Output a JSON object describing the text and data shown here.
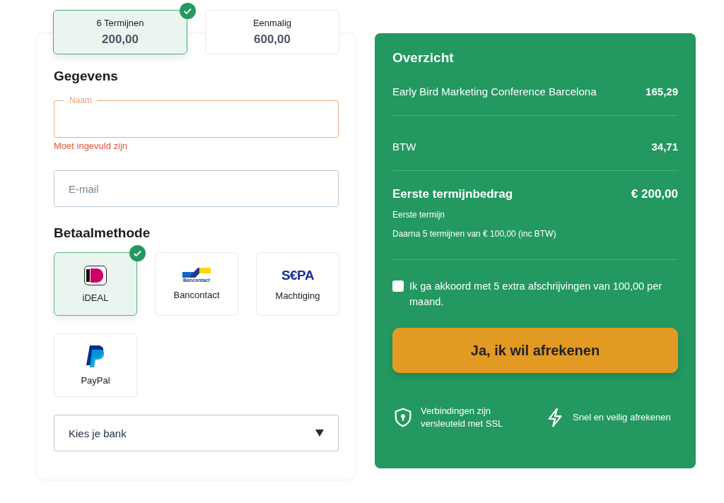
{
  "plans": [
    {
      "label": "6 Termijnen",
      "amount": "200,00",
      "selected": true
    },
    {
      "label": "Eenmalig",
      "amount": "600,00",
      "selected": false
    }
  ],
  "details": {
    "heading": "Gegevens",
    "name_field": {
      "label": "Naam",
      "error": "Moet ingevuld zijn"
    },
    "email_field": {
      "placeholder": "E-mail"
    }
  },
  "payment": {
    "heading": "Betaalmethode",
    "methods": [
      {
        "kind": "ideal",
        "label": "iDEAL",
        "selected": true
      },
      {
        "kind": "bancontact",
        "label": "Bancontact",
        "logo_text": "Bancontact",
        "selected": false
      },
      {
        "kind": "sepa",
        "label": "Machtiging",
        "logo_text": "S€PA",
        "selected": false
      },
      {
        "kind": "paypal",
        "label": "PayPal",
        "selected": false
      }
    ],
    "bank_select": {
      "value": "Kies je bank"
    }
  },
  "summary": {
    "title": "Overzicht",
    "lines": [
      {
        "label": "Early Bird Marketing Conference Barcelona",
        "amount": "165,29"
      },
      {
        "label": "BTW",
        "amount": "34,71"
      }
    ],
    "total": {
      "label": "Eerste termijnbedrag",
      "amount": "€ 200,00",
      "notes": [
        "Eerste termijn",
        "Daarna 5 termijnen van € 100,00 (inc BTW)"
      ]
    },
    "agree": {
      "label": "Ik ga akkoord met 5 extra afschrijvingen van 100,00 per maand.",
      "checked": false
    },
    "button": "Ja, ik wil afrekenen",
    "features": [
      {
        "kind": "shield",
        "text": "Verbindingen zijn versleuteld met SSL"
      },
      {
        "kind": "bolt",
        "text": "Snel en veilig afrekenen"
      }
    ]
  }
}
